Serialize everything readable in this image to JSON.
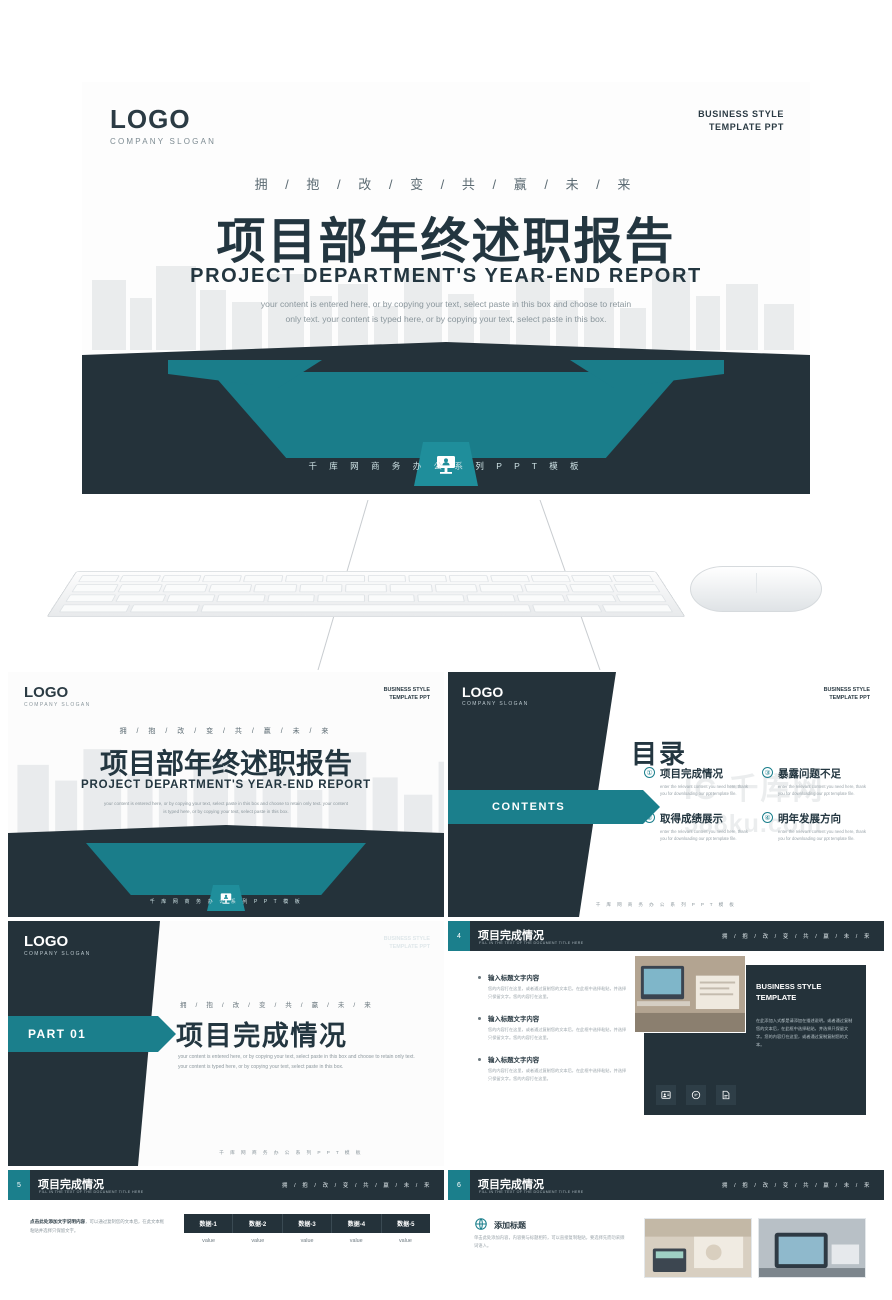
{
  "brand": {
    "logo": "LOGO",
    "slogan": "COMPANY SLOGAN",
    "header_line1": "BUSINESS STYLE",
    "header_line2": "TEMPLATE PPT",
    "accent": "#1b7f8c",
    "dark": "#24323a"
  },
  "hero": {
    "kicker": "拥  /  抱  /  改  /  变  /  共  /  赢  /  未  /  来",
    "title_cn": "项目部年终述职报告",
    "title_en": "PROJECT  DEPARTMENT'S  YEAR-END  REPORT",
    "paragraph": "your content is entered here, or by copying your text, select paste in this box and choose to retain only text. your content is typed here, or by copying your text, select paste in this box.",
    "footer": "千 库 网 商 务 办 公 系 列 P P T 模 板",
    "badge_icon": "presentation-icon"
  },
  "devices": {
    "keyboard": "keyboard-image",
    "mouse": "mouse-image"
  },
  "watermark": {
    "line1": "IC 千库网",
    "line2": "588ku.com"
  },
  "slides": [
    {
      "id": "s1",
      "name": "cover-slide",
      "kicker": "拥 / 抱 / 改 / 变 / 共 / 赢 / 未 / 来",
      "title_cn": "项目部年终述职报告",
      "title_en": "PROJECT  DEPARTMENT'S  YEAR-END  REPORT",
      "paragraph": "your content is entered here, or by copying your text, select paste in this box and choose to retain only text. your content is typed here, or by copying your text, select paste in this box.",
      "footer": "千 库 网 商 务 办 公 系 列 P P T 模 板"
    },
    {
      "id": "s2",
      "name": "contents-slide",
      "title_cn": "目录",
      "tab_label": "CONTENTS",
      "items": [
        {
          "num": "①",
          "heading": "项目完成情况",
          "desc": "enter the relevant content you need here, thank you for downloading our ppt template file."
        },
        {
          "num": "③",
          "heading": "暴露问题不足",
          "desc": "enter the relevant content you need here, thank you for downloading our ppt template file."
        },
        {
          "num": "②",
          "heading": "取得成绩展示",
          "desc": "enter the relevant content you need here, thank you for downloading our ppt template file."
        },
        {
          "num": "④",
          "heading": "明年发展方向",
          "desc": "enter the relevant content you need here, thank you for downloading our ppt template file."
        }
      ],
      "footer": "千 库 网 商 务 办 公 系 列 P P T 模 板"
    },
    {
      "id": "s3",
      "name": "section-divider-slide",
      "tab_label": "PART 01",
      "kicker": "拥 / 抱 / 改 / 变 / 共 / 赢 / 未 / 来",
      "title_cn": "项目完成情况",
      "paragraph": "your content is entered here, or by copying your text, select paste in this box and choose to retain only text. your content is typed here, or by copying your text, select paste in this box.",
      "footer": "千 库 网 商 务 办 公 系 列 P P T 模 板"
    },
    {
      "id": "s4",
      "name": "content-slide-4",
      "page_num": "4",
      "bar_title": "项目完成情况",
      "bar_subtitle": "FILL IN THE TEXT OF THE DOCUMENT TITLE HERE",
      "bar_kicker": "拥 / 抱 / 改 / 变 / 共 / 赢 / 未 / 来",
      "bullets": [
        {
          "heading": "输入标题文字内容",
          "desc": "您的内容打在这里，或者通过复制您的文本后，在此框中选择粘贴，并选择只保留文字。您的内容打在这里。"
        },
        {
          "heading": "输入标题文字内容",
          "desc": "您的内容打在这里，或者通过复制您的文本后，在此框中选择粘贴，并选择只保留文字。您的内容打在这里。"
        },
        {
          "heading": "输入标题文字内容",
          "desc": "您的内容打在这里，或者通过复制您的文本后，在此框中选择粘贴，并选择只保留文字。您的内容打在这里。"
        }
      ],
      "card": {
        "title_line1": "BUSINESS STYLE",
        "title_line2": "TEMPLATE",
        "desc": "在此添加入式都是请添加在描述说明。或者通过复制您的文本后，在此框中选择粘贴，并选择只保留文字。您的内容打在这里，或者通过复制复制您的文本。",
        "icons": [
          "contact-card-icon",
          "support-24-7-icon",
          "edit-document-icon"
        ],
        "photo": "laptop-desk-photo"
      }
    },
    {
      "id": "s5",
      "name": "content-slide-5",
      "page_num": "5",
      "bar_title": "项目完成情况",
      "bar_subtitle": "FILL IN THE TEXT OF THE DOCUMENT TITLE HERE",
      "bar_kicker": "拥 / 抱 / 改 / 变 / 共 / 赢 / 未 / 来",
      "note_bold": "点击此处添加文字说明内容",
      "note": "，可以通过复制您的文本后，在此文本框粘贴并选择只保留文字。",
      "table": {
        "headers": [
          "数据-1",
          "数据-2",
          "数据-3",
          "数据-4",
          "数据-5"
        ],
        "rows": [
          [
            "value",
            "value",
            "value",
            "value",
            "value"
          ]
        ]
      }
    },
    {
      "id": "s6",
      "name": "content-slide-6",
      "page_num": "6",
      "bar_title": "项目完成情况",
      "bar_subtitle": "FILL IN THE TEXT OF THE DOCUMENT TITLE HERE",
      "bar_kicker": "拥 / 抱 / 改 / 变 / 共 / 赢 / 未 / 来",
      "heading": "添加标题",
      "paragraph": "单击此处添加内容，内容要与标题相符，可以直接复制粘贴，要选择先而勿采撷词语入。",
      "photos": [
        "calculator-hands-photo",
        "tablet-desk-photo"
      ],
      "globe_icon": "globe-icon"
    }
  ]
}
